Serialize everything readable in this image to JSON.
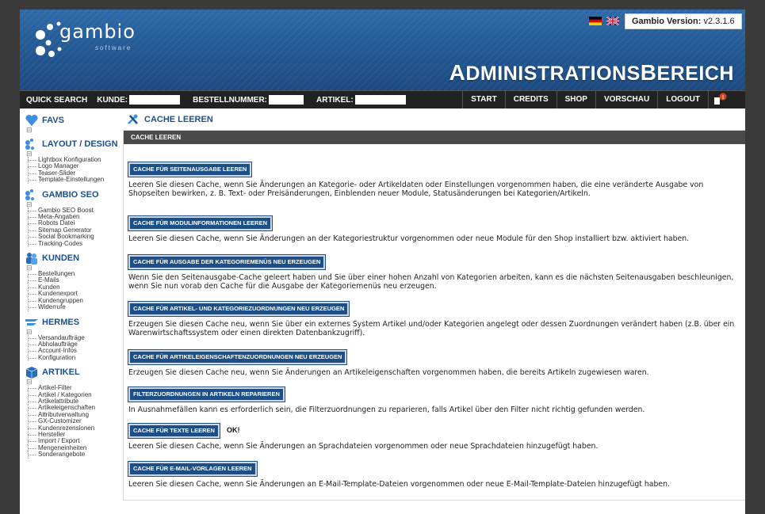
{
  "header": {
    "logo_text": "gambio",
    "logo_sub": "software",
    "version_label": "Gambio Version:",
    "version_value": "v2.3.1.6",
    "admin_title_a": "A",
    "admin_title_b": "DMINISTRATIONS",
    "admin_title_c": "B",
    "admin_title_d": "EREICH"
  },
  "toolbar": {
    "quick_search": "QUICK SEARCH",
    "kunde": "KUNDE:",
    "bestellnummer": "BESTELLNUMMER:",
    "artikel": "ARTIKEL:",
    "nav": [
      "START",
      "CREDITS",
      "SHOP",
      "VORSCHAU",
      "LOGOUT"
    ]
  },
  "sidebar": {
    "sections": [
      {
        "title": "FAVS",
        "items": []
      },
      {
        "title": "LAYOUT / DESIGN",
        "items": [
          "Lightbox Konfiguration",
          "Logo Manager",
          "Teaser-Slider",
          "Template-Einstellungen"
        ]
      },
      {
        "title": "GAMBIO SEO",
        "items": [
          "Gambio SEO Boost",
          "Meta-Angaben",
          "Robots Datei",
          "Sitemap Generator",
          "Social Bookmarking",
          "Tracking-Codes"
        ]
      },
      {
        "title": "KUNDEN",
        "items": [
          "Bestellungen",
          "E-Mails",
          "Kunden",
          "Kundenexport",
          "Kundengruppen",
          "Widerrufe"
        ]
      },
      {
        "title": "HERMES",
        "items": [
          "Versandaufträge",
          "Abholaufträge",
          "Account-Infos",
          "Konfiguration"
        ]
      },
      {
        "title": "ARTIKEL",
        "items": [
          "Artikel-Filter",
          "Artikel / Kategorien",
          "Artikelattribute",
          "Artikeleigenschaften",
          "Attributverwaltung",
          "GX-Customizer",
          "Kundenrezensionen",
          "Hersteller",
          "Import / Export",
          "Mengeneinheiten",
          "Sonderangebote"
        ]
      }
    ]
  },
  "main": {
    "title": "CACHE LEEREN",
    "panel_title": "CACHE LEEREN",
    "items": [
      {
        "button": "CACHE FÜR SEITENAUSGABE LEEREN",
        "desc": "Leeren Sie diesen Cache, wenn Sie Änderungen an Kategorie- oder Artikeldaten oder Einstellungen vorgenommen haben, die eine veränderte Ausgabe von Shopseiten bewirken, z. B. Text- oder Preisänderungen, Einblenden neuer Module, Statusänderungen bei Kategorien/Artikeln.",
        "ok": ""
      },
      {
        "button": "CACHE FÜR MODULINFORMATIONEN LEEREN",
        "desc": "Leeren Sie diesen Cache, wenn Sie Änderungen an der Kategoriestruktur vorgenommen oder neue Module für den Shop installiert bzw. aktiviert haben.",
        "ok": ""
      },
      {
        "button": "CACHE FÜR AUSGABE DER KATEGORIEMENÜS NEU ERZEUGEN",
        "desc": "Wenn Sie den Seitenausgabe-Cache geleert haben und Sie über einer hohen Anzahl von Kategorien arbeiten, kann es die nächsten Seitenausgaben beschleunigen, wenn Sie nun vorab den Cache für die Ausgabe der Kategoriemenüs neu erzeugen.",
        "ok": ""
      },
      {
        "button": "CACHE FÜR ARTIKEL- UND KATEGORIEZUORDNUNGEN NEU ERZEUGEN",
        "desc": "Erzeugen Sie diesen Cache neu, wenn Sie über ein externes System Artikel und/oder Kategorien angelegt oder dessen Zuordnungen verändert haben (z.B. über ein Warenwirtschaftssystem oder einen direkten Datenbankzugriff).",
        "ok": ""
      },
      {
        "button": "CACHE FÜR ARTIKELEIGENSCHAFTENZUORDNUNGEN NEU ERZEUGEN",
        "desc": "Erzeugen Sie diesen Cache neu, wenn Sie Änderungen an Artikeleigenschaften vorgenommen haben, die bereits Artikeln zugewiesen waren.",
        "ok": ""
      },
      {
        "button": "FILTERZUORDNUNGEN IN ARTIKELN REPARIEREN",
        "desc": "In Ausnahmefällen kann es erforderlich sein, die Filterzuordnungen zu reparieren, falls Artikel über den Filter nicht richtig gefunden werden.",
        "ok": ""
      },
      {
        "button": "CACHE FÜR TEXTE LEEREN",
        "desc": "Leeren Sie diesen Cache, wenn Sie Änderungen an Sprachdateien vorgenommen oder neue Sprachdateien hinzugefügt haben.",
        "ok": "OK!"
      },
      {
        "button": "CACHE FÜR E-MAIL-VORLAGEN LEEREN",
        "desc": "Leeren Sie diesen Cache, wenn Sie Änderungen an E-Mail-Template-Dateien vorgenommen oder neue E-Mail-Template-Dateien hinzugefügt haben.",
        "ok": ""
      }
    ]
  }
}
